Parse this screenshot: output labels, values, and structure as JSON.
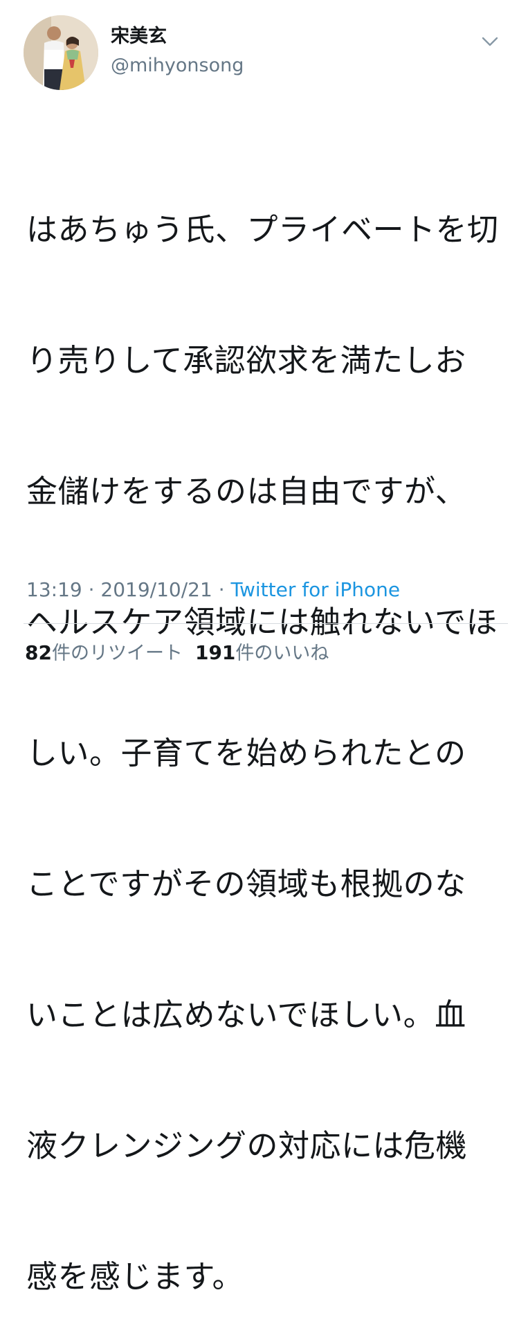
{
  "user": {
    "display_name": "宋美玄",
    "handle": "@mihyonsong",
    "avatar_icon": "profile-photo"
  },
  "tweet": {
    "text": "はあちゅう氏、プライベートを切り売りして承認欲求を満たしお金儲けをするのは自由ですが、ヘルスケア領域には触れないでほしい。子育てを始められたとのことですがその領域も根拠のないことは広めないでほしい。血液クレンジングの対応には危機感を感じます。",
    "lines": [
      "はあちゅう氏、プライベートを切",
      "り売りして承認欲求を満たしお",
      "金儲けをするのは自由ですが、",
      "ヘルスケア領域には触れないでほ",
      "しい。子育てを始められたとの",
      "ことですがその領域も根拠のな",
      "いことは広めないでほしい。血",
      "液クレンジングの対応には危機",
      "感を感じます。"
    ]
  },
  "meta": {
    "time": "13:19",
    "separator": " · ",
    "date": "2019/10/21",
    "source": "Twitter for iPhone"
  },
  "stats": {
    "retweets_count": "82",
    "retweets_label": "件のリツイート",
    "likes_count": "191",
    "likes_label": "件のいいね"
  },
  "icons": {
    "more": "chevron-down-icon"
  },
  "colors": {
    "text": "#14171a",
    "secondary": "#657786",
    "link": "#1b95e0",
    "divider": "#d6dbdf"
  }
}
